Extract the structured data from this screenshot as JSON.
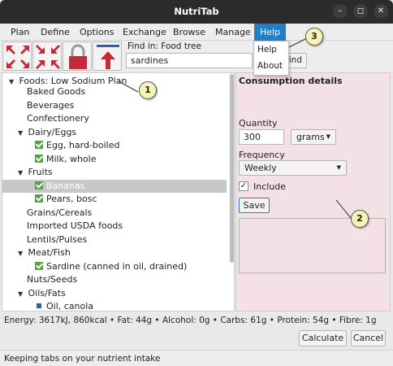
{
  "window": {
    "title": "NutriTab",
    "minimize": "–",
    "maximize": "◻",
    "close": "✕"
  },
  "menubar": {
    "items": [
      "Plan",
      "Define",
      "Options",
      "Exchange",
      "Browse",
      "Manage",
      "Help"
    ],
    "active": "Help"
  },
  "help_menu": {
    "items": [
      "Help",
      "About"
    ]
  },
  "toolbar": {
    "icons": [
      "collapse-arrows-icon",
      "expand-arrows-icon",
      "lock-icon",
      "move-to-top-icon"
    ],
    "find_label": "Find in: Food tree",
    "find_value": "sardines",
    "find_button": "Find"
  },
  "tree": {
    "root": "Foods: Low Sodium Plan",
    "nodes": [
      {
        "label": "Baked Goods",
        "level": 1,
        "kind": "group"
      },
      {
        "label": "Beverages",
        "level": 1,
        "kind": "group"
      },
      {
        "label": "Confectionery",
        "level": 1,
        "kind": "group"
      },
      {
        "label": "Dairy/Eggs",
        "level": 1,
        "kind": "expanded"
      },
      {
        "label": "Egg, hard-boiled",
        "level": 2,
        "kind": "checked"
      },
      {
        "label": "Milk, whole",
        "level": 2,
        "kind": "checked"
      },
      {
        "label": "Fruits",
        "level": 1,
        "kind": "expanded"
      },
      {
        "label": "Bananas",
        "level": 2,
        "kind": "checked",
        "selected": true
      },
      {
        "label": "Pears, bosc",
        "level": 2,
        "kind": "checked"
      },
      {
        "label": "Grains/Cereals",
        "level": 1,
        "kind": "group"
      },
      {
        "label": "Imported USDA foods",
        "level": 1,
        "kind": "group"
      },
      {
        "label": "Lentils/Pulses",
        "level": 1,
        "kind": "group"
      },
      {
        "label": "Meat/Fish",
        "level": 1,
        "kind": "expanded"
      },
      {
        "label": "Sardine (canned in oil, drained)",
        "level": 2,
        "kind": "checked"
      },
      {
        "label": "Nuts/Seeds",
        "level": 1,
        "kind": "group"
      },
      {
        "label": "Oils/Fats",
        "level": 1,
        "kind": "expanded"
      },
      {
        "label": "Oil, canola",
        "level": 2,
        "kind": "square"
      }
    ]
  },
  "details": {
    "title": "Consumption details",
    "quantity_label": "Quantity",
    "quantity_value": "300",
    "unit": "grams",
    "frequency_label": "Frequency",
    "frequency_value": "Weekly",
    "include_label": "Include",
    "include_checked": true,
    "save_label": "Save"
  },
  "summary": "Energy: 3617kJ, 860kcal • Fat: 44g • Alcohol: 0g • Carbs: 61g • Protein: 54g • Fibre: 1g",
  "buttons": {
    "calculate": "Calculate",
    "cancel": "Cancel"
  },
  "statusbar": "Keeping tabs on your nutrient intake",
  "callouts": [
    "1",
    "2",
    "3"
  ],
  "colors": {
    "accent": "#1f7fc9",
    "detail_bg": "#f4e1e6",
    "icon_red": "#c42a3a",
    "check_green": "#58a146"
  }
}
